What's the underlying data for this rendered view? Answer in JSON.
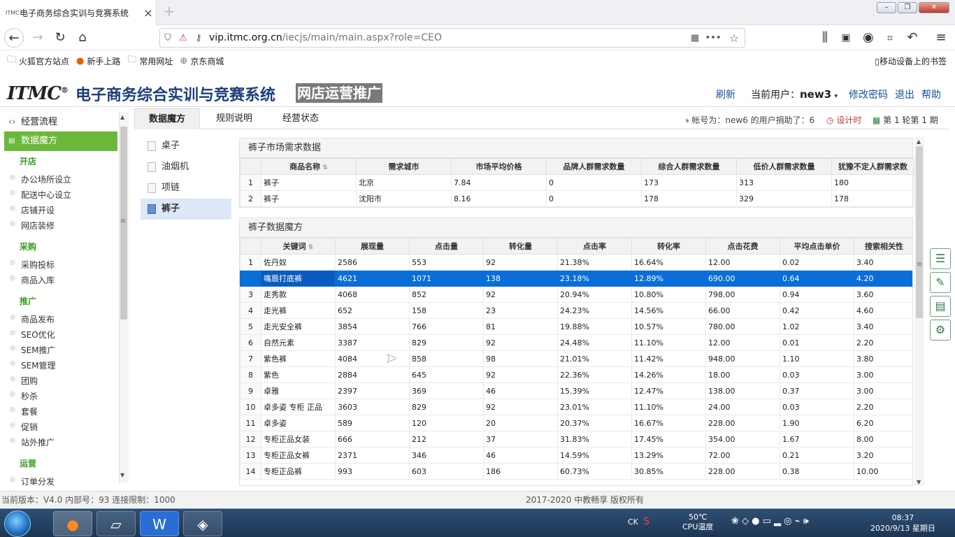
{
  "browser": {
    "tab_title": "电子商务综合实训与竞赛系统",
    "tab_favicon": "ITMC",
    "url_host": "vip.itmc.org.cn",
    "url_path": "/iecjs/main/main.aspx?role=CEO",
    "bookmarks": [
      "火狐官方站点",
      "新手上路",
      "常用网址",
      "京东商城"
    ],
    "mobile_bookmarks": "移动设备上的书签"
  },
  "header": {
    "logo": "ITMC",
    "logo_reg": "®",
    "app_name": "电子商务综合实训与竞赛系统",
    "app_tag": "网店运营推广",
    "refresh": "刷新",
    "current_user_label": "当前用户：",
    "current_user": "new3",
    "change_password": "修改密码",
    "logout": "退出",
    "help": "帮助"
  },
  "sidebar": {
    "process": "经营流程",
    "active": "数据魔方",
    "sections": [
      {
        "title": "开店",
        "items": [
          "办公场所设立",
          "配送中心设立",
          "店铺开设",
          "网店装修"
        ]
      },
      {
        "title": "采购",
        "items": [
          "采购投标",
          "商品入库"
        ]
      },
      {
        "title": "推广",
        "items": [
          "商品发布",
          "SEO优化",
          "SEM推广",
          "SEM管理",
          "团购",
          "秒杀",
          "套餐",
          "促销",
          "站外推广"
        ]
      },
      {
        "title": "运营",
        "items": [
          "订单分发"
        ]
      }
    ]
  },
  "tabs": [
    "数据魔方",
    "规则说明",
    "经营状态"
  ],
  "status": {
    "donation": "帐号为：new6 的用户捐助了：6",
    "design_time": "设计时",
    "round": "第 1 轮第 1 期"
  },
  "categories": [
    "桌子",
    "油烟机",
    "项链",
    "裤子"
  ],
  "demand": {
    "title": "裤子市场需求数据",
    "columns": [
      "商品名称",
      "需求城市",
      "市场平均价格",
      "品牌人群需求数量",
      "综合人群需求数量",
      "低价人群需求数量",
      "犹豫不定人群需求数"
    ],
    "rows": [
      [
        "1",
        "裤子",
        "北京",
        "7.84",
        "0",
        "173",
        "313",
        "180"
      ],
      [
        "2",
        "裤子",
        "沈阳市",
        "8.16",
        "0",
        "178",
        "329",
        "178"
      ]
    ]
  },
  "magic": {
    "title": "裤子数据魔方",
    "columns": [
      "关键词",
      "展现量",
      "点击量",
      "转化量",
      "点击率",
      "转化率",
      "点击花费",
      "平均点击单价",
      "搜索相关性"
    ],
    "rows": [
      [
        "1",
        "佐丹奴",
        "2586",
        "553",
        "92",
        "21.38%",
        "16.64%",
        "12.00",
        "0.02",
        "3.40"
      ],
      [
        "",
        "嘴唇打底裤",
        "4621",
        "1071",
        "138",
        "23.18%",
        "12.89%",
        "690.00",
        "0.64",
        "4.20"
      ],
      [
        "3",
        "走秀款",
        "4068",
        "852",
        "92",
        "20.94%",
        "10.80%",
        "798.00",
        "0.94",
        "3.60"
      ],
      [
        "4",
        "走光裤",
        "652",
        "158",
        "23",
        "24.23%",
        "14.56%",
        "66.00",
        "0.42",
        "4.60"
      ],
      [
        "5",
        "走光安全裤",
        "3854",
        "766",
        "81",
        "19.88%",
        "10.57%",
        "780.00",
        "1.02",
        "3.40"
      ],
      [
        "6",
        "自然元素",
        "3387",
        "829",
        "92",
        "24.48%",
        "11.10%",
        "12.00",
        "0.01",
        "2.20"
      ],
      [
        "7",
        "紫色裤",
        "4084",
        "858",
        "98",
        "21.01%",
        "11.42%",
        "948.00",
        "1.10",
        "3.80"
      ],
      [
        "8",
        "紫色",
        "2884",
        "645",
        "92",
        "22.36%",
        "14.26%",
        "18.00",
        "0.03",
        "3.00"
      ],
      [
        "9",
        "卓雅",
        "2397",
        "369",
        "46",
        "15.39%",
        "12.47%",
        "138.00",
        "0.37",
        "3.00"
      ],
      [
        "10",
        "卓多姿 专柜 正品",
        "3603",
        "829",
        "92",
        "23.01%",
        "11.10%",
        "24.00",
        "0.03",
        "2.20"
      ],
      [
        "11",
        "卓多姿",
        "589",
        "120",
        "20",
        "20.37%",
        "16.67%",
        "228.00",
        "1.90",
        "6.20"
      ],
      [
        "12",
        "专柜正品女装",
        "666",
        "212",
        "37",
        "31.83%",
        "17.45%",
        "354.00",
        "1.67",
        "8.00"
      ],
      [
        "13",
        "专柜正品女裤",
        "2371",
        "346",
        "46",
        "14.59%",
        "13.29%",
        "72.00",
        "0.21",
        "3.20"
      ],
      [
        "14",
        "专柜正品裤",
        "993",
        "603",
        "186",
        "60.73%",
        "30.85%",
        "228.00",
        "0.38",
        "10.00"
      ]
    ]
  },
  "footer": {
    "version": "当前版本：V4.0 内部号：93 连接限制：1000",
    "copyright": "2017-2020 中教畅享 版权所有"
  },
  "taskbar": {
    "temp": "50℃",
    "temp_label": "CPU温度",
    "ck": "CK",
    "time": "08:37",
    "date": "2020/9/13 星期日"
  },
  "colors": {
    "accent_green": "#6bb83b",
    "selected_row": "#0a6ed8",
    "link_blue": "#1b4e9c"
  }
}
